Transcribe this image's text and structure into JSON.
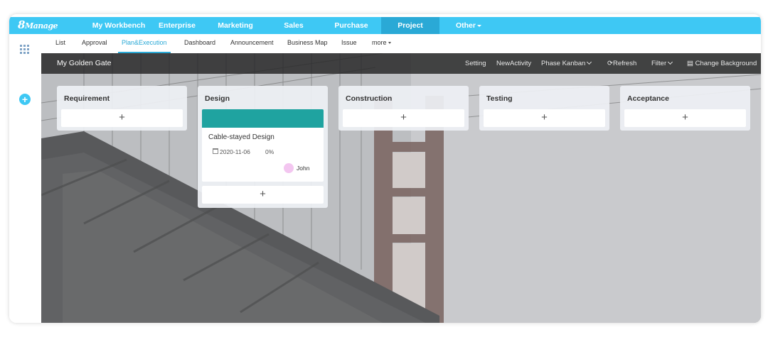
{
  "app": {
    "logo_main": "8",
    "logo_text": "Manage",
    "nav": [
      {
        "label": "My Workbench"
      },
      {
        "label": "Enterprise"
      },
      {
        "label": "Marketing"
      },
      {
        "label": "Sales"
      },
      {
        "label": "Purchase"
      },
      {
        "label": "Project",
        "active": true
      },
      {
        "label": "Other"
      }
    ],
    "accent": "#3ec8f4"
  },
  "subnav": [
    {
      "label": "List"
    },
    {
      "label": "Approval"
    },
    {
      "label": "Plan&Execution",
      "active": true
    },
    {
      "label": "Dashboard"
    },
    {
      "label": "Announcement"
    },
    {
      "label": "Business Map"
    },
    {
      "label": "Issue"
    },
    {
      "label": "more"
    }
  ],
  "board": {
    "title": "My Golden Gate",
    "toolbar": {
      "setting": "Setting",
      "new_activity": "NewActivity",
      "phase_kanban": "Phase Kanban",
      "refresh": "Refresh",
      "filter": "Filter",
      "change_background": "Change Background"
    },
    "columns": [
      {
        "title": "Requirement",
        "add": "+"
      },
      {
        "title": "Design",
        "add": "+"
      },
      {
        "title": "Construction",
        "add": "+"
      },
      {
        "title": "Testing",
        "add": "+"
      },
      {
        "title": "Acceptance",
        "add": "+"
      }
    ],
    "task": {
      "name": "Cable-stayed Design",
      "date": "2020-11-06",
      "progress": "0%",
      "assignee": "John",
      "bar_color": "#1fa3a0"
    }
  }
}
